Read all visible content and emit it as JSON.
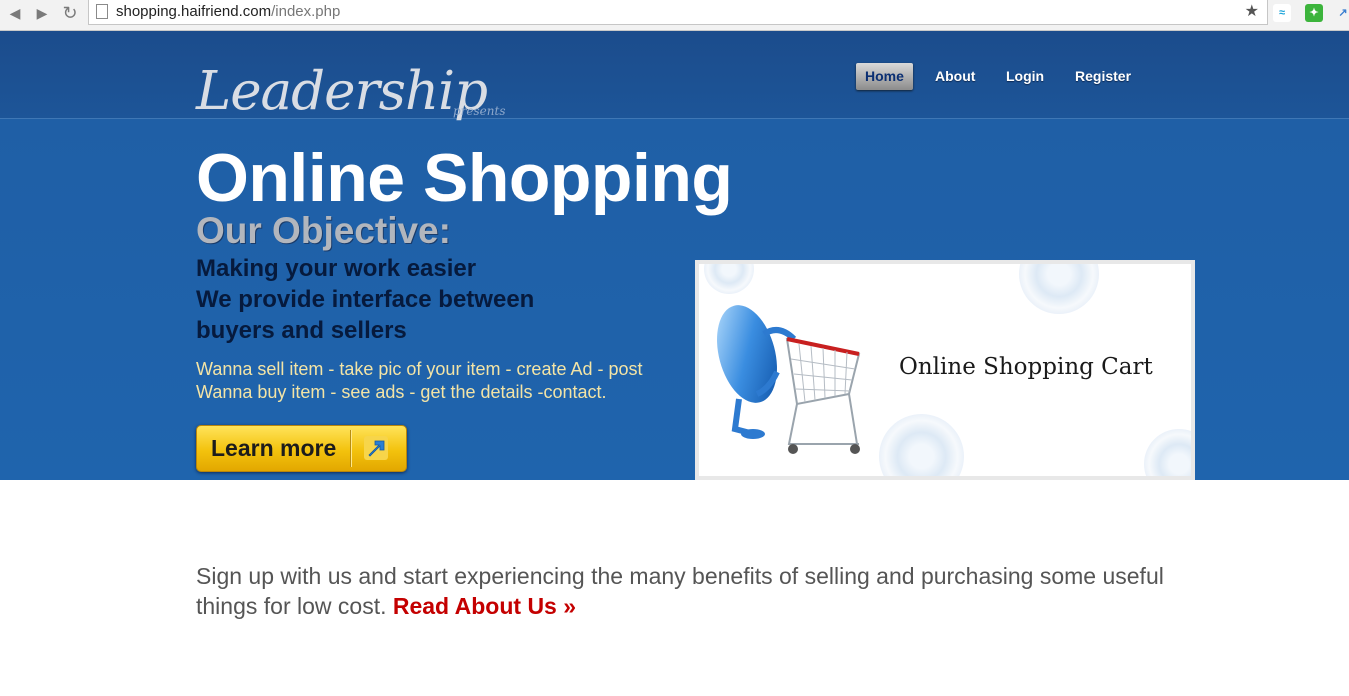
{
  "browser": {
    "url_host": "shopping.haifriend.com",
    "url_path": "/index.php"
  },
  "site": {
    "logo": "Leadership",
    "logo_suffix": "presents"
  },
  "nav": {
    "items": [
      {
        "label": "Home",
        "active": true
      },
      {
        "label": "About",
        "active": false
      },
      {
        "label": "Login",
        "active": false
      },
      {
        "label": "Register",
        "active": false
      }
    ]
  },
  "hero": {
    "title": "Online Shopping",
    "objective": "Our Objective:",
    "tagline": [
      "Making your work easier",
      "We provide interface between",
      "buyers and sellers"
    ],
    "steps": [
      "Wanna sell item - take pic of your item - create Ad - post",
      "Wanna buy item - see ads - get the details -contact."
    ],
    "button_label": "Learn more"
  },
  "promo": {
    "caption": "Online Shopping Cart"
  },
  "signup": {
    "text": "Sign up with us and start experiencing the many benefits of selling and purchasing some useful things for low cost.",
    "link": "Read About Us »"
  },
  "colors": {
    "hero_blue": "#1f5fa6",
    "accent_yellow": "#f3c20d",
    "link_red": "#c40000"
  }
}
